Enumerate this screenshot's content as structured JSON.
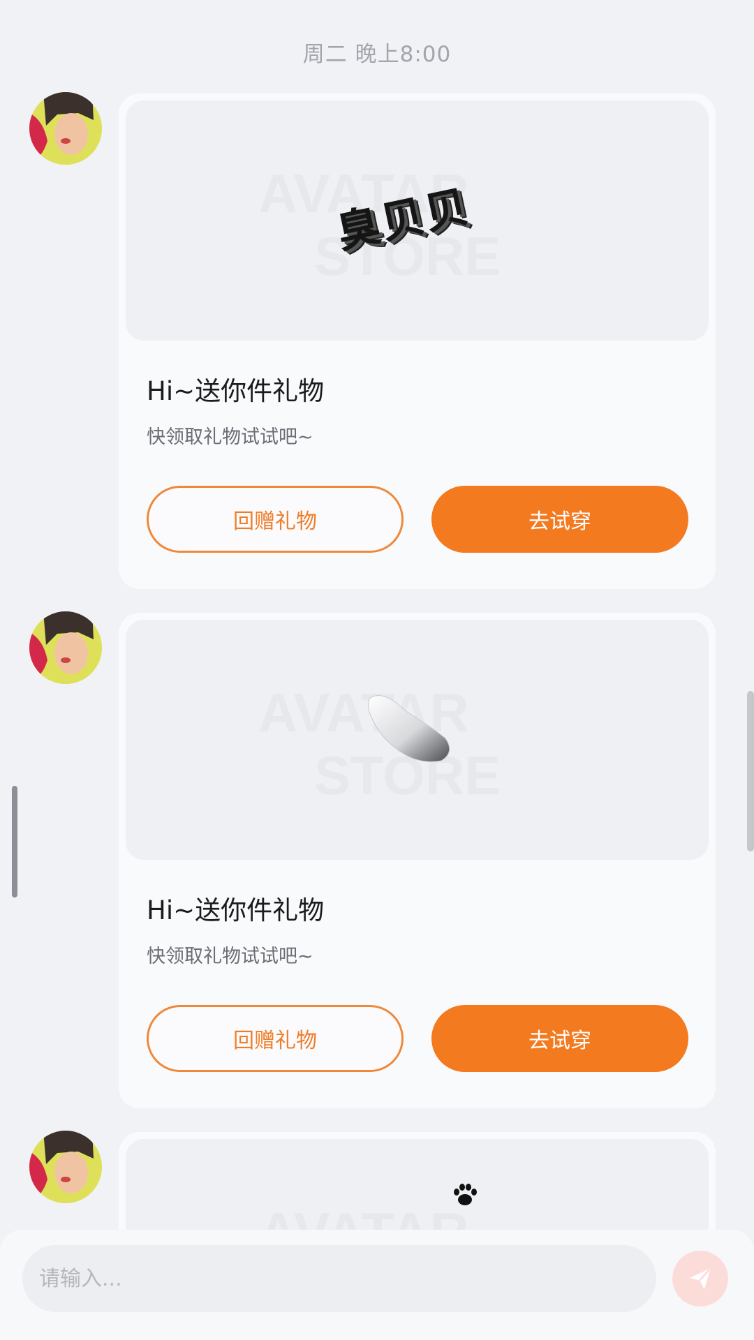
{
  "timestamp": "周二 晚上8:00",
  "watermark": {
    "line1": "AVATAR",
    "line2": "STORE"
  },
  "messages": [
    {
      "image_label": "臭贝贝",
      "title": "Hi~送你件礼物",
      "subtitle": "快领取礼物试试吧~",
      "return_gift_label": "回赠礼物",
      "try_on_label": "去试穿"
    },
    {
      "image_label": "",
      "title": "Hi~送你件礼物",
      "subtitle": "快领取礼物试试吧~",
      "return_gift_label": "回赠礼物",
      "try_on_label": "去试穿"
    },
    {
      "image_label": "",
      "title": "",
      "subtitle": "",
      "return_gift_label": "",
      "try_on_label": ""
    }
  ],
  "input": {
    "placeholder": "请输入..."
  },
  "colors": {
    "accent": "#f47a20",
    "background": "#f1f2f6",
    "send_button_bg": "#fcdcd8"
  },
  "icons": {
    "send": "paper-plane-icon",
    "paw": "paw-print-icon"
  }
}
